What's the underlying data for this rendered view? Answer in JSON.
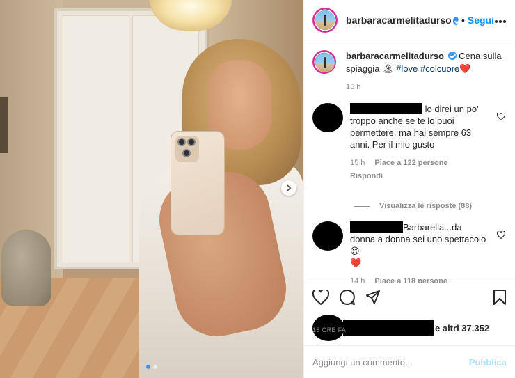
{
  "post": {
    "username": "barbaracarmelitadurso",
    "dot": "•",
    "follow_label": "Segui",
    "more_icon": "more-horizontal-icon"
  },
  "caption": {
    "username": "barbaracarmelitadurso",
    "text": "Cena sulla spiaggia",
    "emoji_island": "🏝",
    "tags": "#love #colcuore",
    "emoji_heart": "❤️",
    "time": "15 h"
  },
  "comments": [
    {
      "text_line1": "lo direi un po'",
      "text_rest": "troppo anche se te lo puoi permettere, ma hai sempre 63 anni. Per il mio gusto",
      "time": "15 h",
      "likes": "Piace a 122 persone",
      "reply": "Rispondi"
    },
    {
      "text_line1": "Barbarella...da donna",
      "text_rest": "a donna sei uno spettacolo 😍",
      "text_emoji": "❤️",
      "time": "14 h",
      "likes": "Piace a 118 persone",
      "reply": ""
    }
  ],
  "view_replies": "Visualizza le risposte (88)",
  "likes_text": "e altri 37.352",
  "time_ago": "15 ORE FA",
  "composer": {
    "placeholder": "Aggiungi un commento...",
    "publish_label": "Pubblica"
  },
  "colors": {
    "accent": "#0095f6",
    "publish_disabled": "#b2dffc",
    "heart": "#ed4956",
    "verified": "#3897f0"
  }
}
